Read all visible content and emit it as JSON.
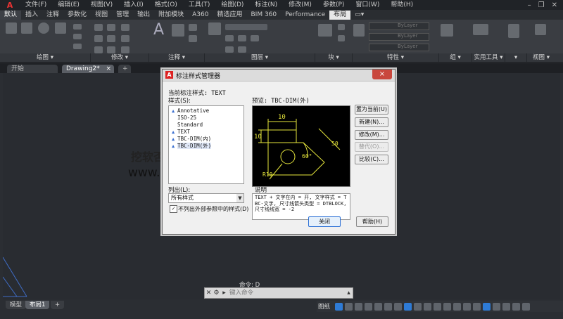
{
  "menubar": {
    "items": [
      "文件(F)",
      "编辑(E)",
      "视图(V)",
      "插入(I)",
      "格式(O)",
      "工具(T)",
      "绘图(D)",
      "标注(N)",
      "修改(M)",
      "参数(P)",
      "窗口(W)",
      "帮助(H)"
    ]
  },
  "ribbon_tabs": [
    "默认",
    "插入",
    "注释",
    "参数化",
    "视图",
    "管理",
    "输出",
    "附加模块",
    "A360",
    "精选应用",
    "BIM 360",
    "Performance",
    "布局"
  ],
  "ribbon_panels": [
    "绘图 ▾",
    "修改 ▾",
    "注释 ▾",
    "图层 ▾",
    "块 ▾",
    "特性 ▾",
    "组 ▾",
    "实用工具 ▾",
    "▾",
    "视图 ▾"
  ],
  "ribbon_props": [
    "ByLayer",
    "ByLayer",
    "ByLayer"
  ],
  "doc_tabs": {
    "start": "开始",
    "drawing": "Drawing2*",
    "close": "×",
    "add": "+"
  },
  "layout_tabs": {
    "model": "模型",
    "layout": "布局1",
    "add": "+"
  },
  "status": {
    "paper": "图纸"
  },
  "command": {
    "history": "命令: D",
    "placeholder": "键入命令"
  },
  "dialog": {
    "title": "标注样式管理器",
    "close": "×",
    "current_label": "当前标注样式: TEXT",
    "styles_label": "样式(S):",
    "styles": [
      {
        "name": "Annotative",
        "annotative": true
      },
      {
        "name": "ISO-25",
        "annotative": false
      },
      {
        "name": "Standard",
        "annotative": false
      },
      {
        "name": "TEXT",
        "annotative": true
      },
      {
        "name": "TBC-DIM(内)",
        "annotative": true
      },
      {
        "name": "TBC-DIM(外)",
        "annotative": true
      }
    ],
    "preview_label": "预览: TBC-DIM(外)",
    "preview_dims": {
      "top": "10",
      "left": "10",
      "angle": "60°",
      "diag": "50",
      "radius": "R10"
    },
    "buttons": {
      "set_current": "置为当前(U)",
      "new": "新建(N)...",
      "modify": "修改(M)...",
      "override": "替代(O)...",
      "compare": "比较(C)..."
    },
    "list_label": "列出(L):",
    "list_value": "所有样式",
    "exclude_xref": "不列出外部参照中的样式(D)",
    "exclude_checked": true,
    "desc_label": "说明",
    "desc_text": "TEXT + 文字在内 = 开, 文字样式 = TBC-文字, 尺寸线箭头类型 = DTBLOCK, 尺寸线线宽 = -2",
    "close_btn": "关闭",
    "help_btn": "帮助(H)"
  },
  "watermark": {
    "line1": "挖软否",
    "line2": "www.wrfou.com"
  }
}
